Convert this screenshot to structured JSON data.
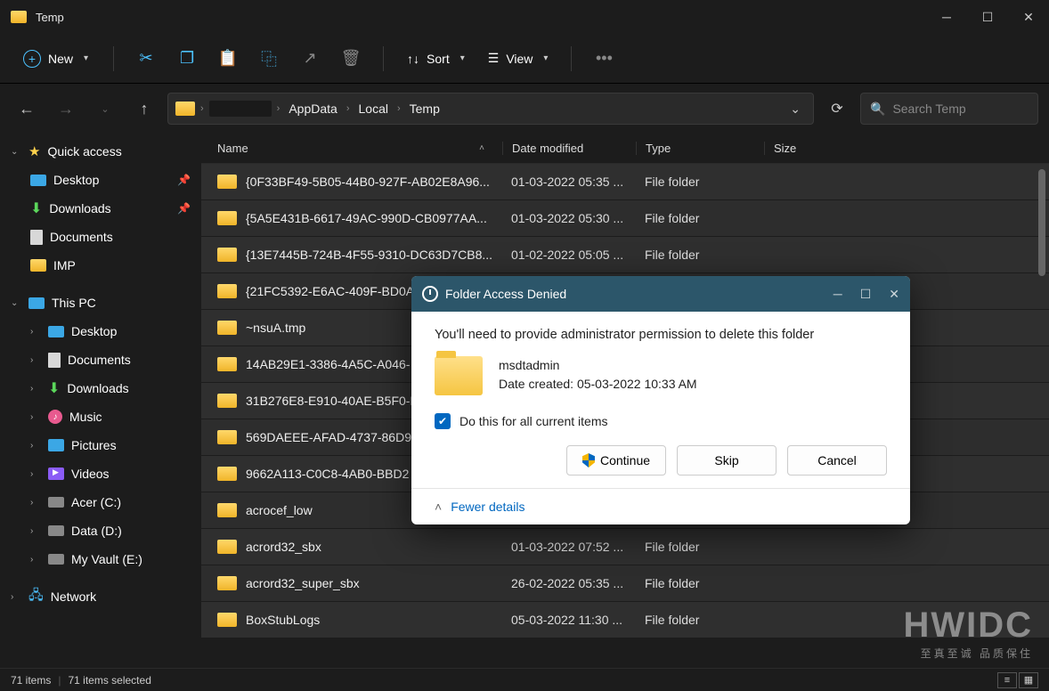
{
  "window": {
    "title": "Temp"
  },
  "toolbar": {
    "new": "New",
    "sort": "Sort",
    "view": "View"
  },
  "breadcrumb": {
    "items": [
      "AppData",
      "Local",
      "Temp"
    ]
  },
  "search": {
    "placeholder": "Search Temp"
  },
  "sidebar": {
    "quick": "Quick access",
    "q_items": [
      {
        "label": "Desktop",
        "icon": "desktop",
        "pin": true
      },
      {
        "label": "Downloads",
        "icon": "down",
        "pin": true
      },
      {
        "label": "Documents",
        "icon": "doc",
        "pin": false
      },
      {
        "label": "IMP",
        "icon": "folder",
        "pin": false
      }
    ],
    "thispc": "This PC",
    "pc_items": [
      {
        "label": "Desktop",
        "icon": "desktop"
      },
      {
        "label": "Documents",
        "icon": "doc"
      },
      {
        "label": "Downloads",
        "icon": "down"
      },
      {
        "label": "Music",
        "icon": "music"
      },
      {
        "label": "Pictures",
        "icon": "pic"
      },
      {
        "label": "Videos",
        "icon": "video"
      },
      {
        "label": "Acer (C:)",
        "icon": "drive"
      },
      {
        "label": "Data (D:)",
        "icon": "drive"
      },
      {
        "label": "My Vault (E:)",
        "icon": "drive"
      }
    ],
    "network": "Network"
  },
  "columns": {
    "name": "Name",
    "date": "Date modified",
    "type": "Type",
    "size": "Size"
  },
  "files": [
    {
      "name": "{0F33BF49-5B05-44B0-927F-AB02E8A96...",
      "date": "01-03-2022 05:35 ...",
      "type": "File folder"
    },
    {
      "name": "{5A5E431B-6617-49AC-990D-CB0977AA...",
      "date": "01-03-2022 05:30 ...",
      "type": "File folder"
    },
    {
      "name": "{13E7445B-724B-4F55-9310-DC63D7CB8...",
      "date": "01-02-2022 05:05 ...",
      "type": "File folder"
    },
    {
      "name": "{21FC5392-E6AC-409F-BD0A",
      "date": "",
      "type": ""
    },
    {
      "name": "~nsuA.tmp",
      "date": "",
      "type": ""
    },
    {
      "name": "14AB29E1-3386-4A5C-A046-",
      "date": "",
      "type": ""
    },
    {
      "name": "31B276E8-E910-40AE-B5F0-F",
      "date": "",
      "type": ""
    },
    {
      "name": "569DAEEE-AFAD-4737-86D9",
      "date": "",
      "type": ""
    },
    {
      "name": "9662A113-C0C8-4AB0-BBD2",
      "date": "",
      "type": ""
    },
    {
      "name": "acrocef_low",
      "date": "",
      "type": ""
    },
    {
      "name": "acrord32_sbx",
      "date": "01-03-2022 07:52 ...",
      "type": "File folder"
    },
    {
      "name": "acrord32_super_sbx",
      "date": "26-02-2022 05:35 ...",
      "type": "File folder"
    },
    {
      "name": "BoxStubLogs",
      "date": "05-03-2022 11:30 ...",
      "type": "File folder"
    }
  ],
  "status": {
    "count": "71 items",
    "selected": "71 items selected"
  },
  "dialog": {
    "title": "Folder Access Denied",
    "message": "You'll need to provide administrator permission to delete this folder",
    "obj_name": "msdtadmin",
    "obj_date": "Date created: 05-03-2022 10:33 AM",
    "check": "Do this for all current items",
    "btn_continue": "Continue",
    "btn_skip": "Skip",
    "btn_cancel": "Cancel",
    "fewer": "Fewer details"
  },
  "watermark": {
    "big": "HWIDC",
    "small": "至真至诚 品质保住"
  }
}
